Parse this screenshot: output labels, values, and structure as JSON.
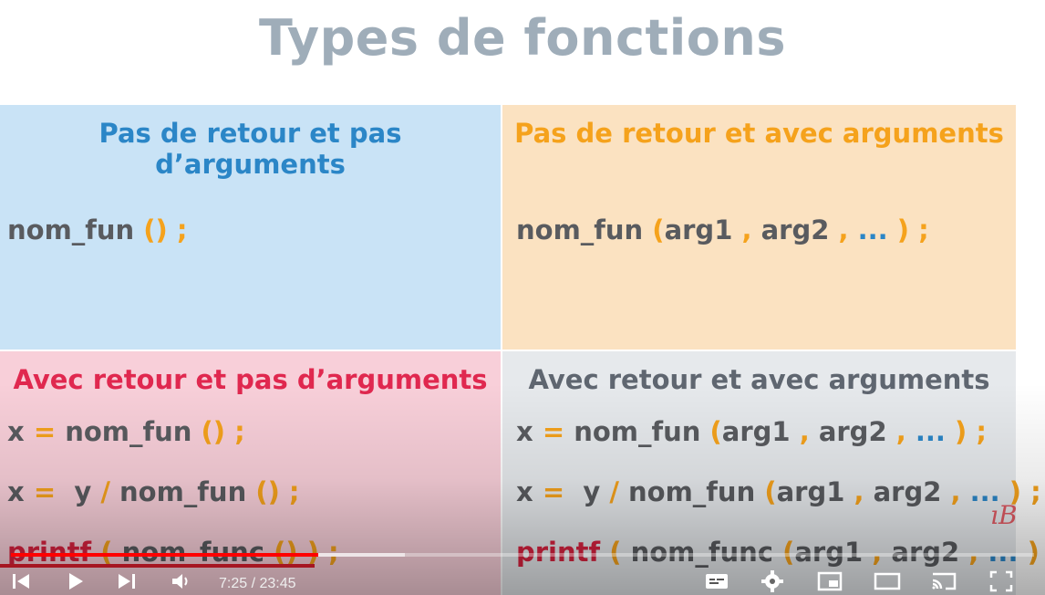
{
  "slide": {
    "title": "Types de fonctions",
    "quadrants": [
      {
        "heading": "Pas de retour et pas d’arguments",
        "heading_color": "#2b86c7",
        "background": "#c9e3f6",
        "code": {
          "line1_fun": "nom_fun ",
          "line1_paren": "()",
          "line1_semi": " ;"
        }
      },
      {
        "heading": "Pas de retour et avec arguments",
        "heading_color": "#f5a21c",
        "background": "#fbe2c1",
        "code": {
          "fun": "nom_fun ",
          "open": "(",
          "arg1": "arg1",
          "comma1": " , ",
          "arg2": "arg2",
          "comma2": " , ",
          "ellipsis": "...",
          "close": " )",
          "semi": " ;"
        }
      },
      {
        "heading": "Avec retour et pas d’arguments",
        "heading_color": "#e0284f",
        "background": "#f8cfd9",
        "lines": [
          {
            "x": "x",
            "eq": " = ",
            "fun": "nom_fun ",
            "paren": "()",
            "semi": " ;"
          },
          {
            "x": "x",
            "eq": " =  ",
            "y": "y",
            "div": " / ",
            "fun": "nom_fun ",
            "paren": "()",
            "semi": " ;"
          },
          {
            "printf": "printf",
            "open": " ( ",
            "func": "nom_func ",
            "paren": "()",
            "close": " ) ;"
          }
        ]
      },
      {
        "heading": "Avec retour et avec arguments",
        "heading_color": "#5f6670",
        "background": "#e6e9ec",
        "lines": [
          {
            "x": "x",
            "eq": " = ",
            "fun": "nom_fun ",
            "open": "(",
            "arg1": "arg1",
            "c1": " , ",
            "arg2": "arg2",
            "c2": " , ",
            "ell": "...",
            "close": " )",
            "semi": " ;"
          },
          {
            "x": "x",
            "eq": " =  ",
            "y": "y",
            "div": " / ",
            "fun": "nom_fun ",
            "open": "(",
            "arg1": "arg1",
            "c1": " , ",
            "arg2": "arg2",
            "c2": " , ",
            "ell": "...",
            "close": " )",
            "semi": " ;"
          },
          {
            "printf": "printf",
            "open": " ( ",
            "func": "nom_func ",
            "open2": "(",
            "arg1": "arg1",
            "c1": " , ",
            "arg2": "arg2",
            "c2": " , ",
            "ell": "...",
            "close2": " )",
            "close": " ) ;"
          }
        ]
      }
    ],
    "annotation_mark": "ıB"
  },
  "player": {
    "time_display": "7:25 / 23:45",
    "progress": {
      "played_fraction": 0.3,
      "buffered_fraction": 0.385
    },
    "icons": [
      "previous-icon",
      "play-icon",
      "next-icon",
      "volume-icon",
      "subtitles-icon",
      "settings-icon",
      "miniplayer-icon",
      "theater-mode-icon",
      "cast-icon",
      "fullscreen-icon"
    ]
  }
}
